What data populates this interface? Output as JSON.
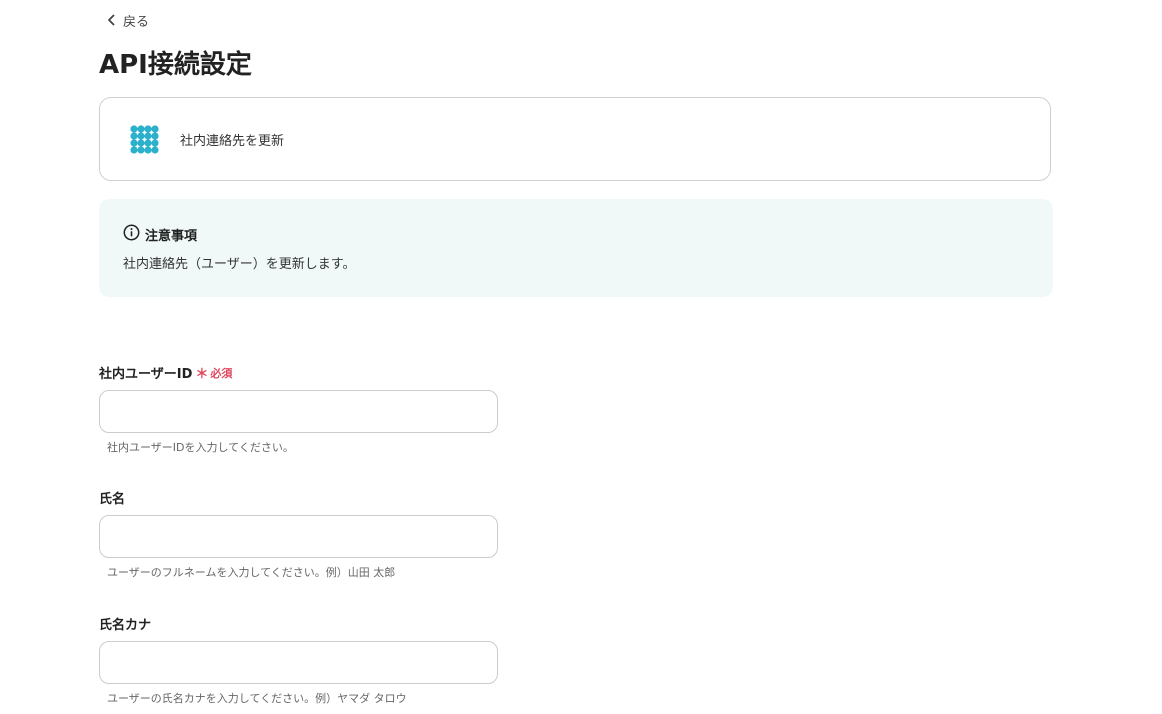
{
  "nav": {
    "back_label": "戻る"
  },
  "page": {
    "title": "API接続設定"
  },
  "app_card": {
    "icon": "dot-grid-icon",
    "icon_color": "#2bb1cc",
    "action_name": "社内連絡先を更新"
  },
  "notice": {
    "icon": "info-circle-icon",
    "title": "注意事項",
    "body": "社内連絡先（ユーザー）を更新します。",
    "background": "#f1f9f8"
  },
  "fields": [
    {
      "label": "社内ユーザーID",
      "required": true,
      "required_mark": "＊",
      "required_text": "必須",
      "value": "",
      "help": "社内ユーザーIDを入力してください。"
    },
    {
      "label": "氏名",
      "required": false,
      "value": "",
      "help": "ユーザーのフルネームを入力してください。例）山田 太郎"
    },
    {
      "label": "氏名カナ",
      "required": false,
      "value": "",
      "help": "ユーザーの氏名カナを入力してください。例）ヤマダ タロウ"
    }
  ],
  "colors": {
    "required": "#e0485f",
    "border": "#cccccc"
  }
}
